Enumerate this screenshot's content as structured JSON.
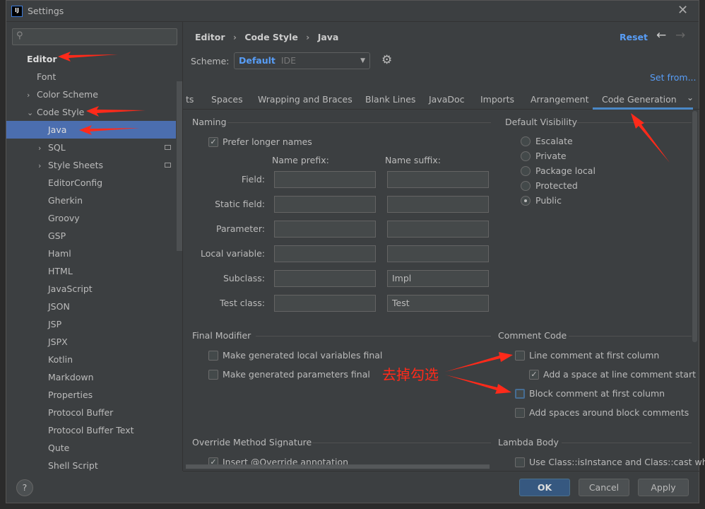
{
  "window": {
    "title": "Settings",
    "logo": "IJ"
  },
  "search": {
    "placeholder": ""
  },
  "sidebar": {
    "items": [
      {
        "label": "Editor",
        "level": 0,
        "bold": true
      },
      {
        "label": "Font",
        "level": 1
      },
      {
        "label": "Color Scheme",
        "level": 1,
        "chevron": "right"
      },
      {
        "label": "Code Style",
        "level": 1,
        "chevron": "down"
      },
      {
        "label": "Java",
        "level": 2,
        "selected": true
      },
      {
        "label": "SQL",
        "level": 2,
        "chevron": "right",
        "badge": true
      },
      {
        "label": "Style Sheets",
        "level": 2,
        "chevron": "right",
        "badge": true
      },
      {
        "label": "EditorConfig",
        "level": 2
      },
      {
        "label": "Gherkin",
        "level": 2
      },
      {
        "label": "Groovy",
        "level": 2
      },
      {
        "label": "GSP",
        "level": 2
      },
      {
        "label": "Haml",
        "level": 2
      },
      {
        "label": "HTML",
        "level": 2
      },
      {
        "label": "JavaScript",
        "level": 2
      },
      {
        "label": "JSON",
        "level": 2
      },
      {
        "label": "JSP",
        "level": 2
      },
      {
        "label": "JSPX",
        "level": 2
      },
      {
        "label": "Kotlin",
        "level": 2
      },
      {
        "label": "Markdown",
        "level": 2
      },
      {
        "label": "Properties",
        "level": 2
      },
      {
        "label": "Protocol Buffer",
        "level": 2
      },
      {
        "label": "Protocol Buffer Text",
        "level": 2
      },
      {
        "label": "Qute",
        "level": 2
      },
      {
        "label": "Shell Script",
        "level": 2
      }
    ]
  },
  "breadcrumb": [
    "Editor",
    "Code Style",
    "Java"
  ],
  "header": {
    "reset": "Reset",
    "scheme_label": "Scheme:",
    "scheme_value": "Default",
    "scheme_sub": "IDE",
    "set_from": "Set from..."
  },
  "tabs": [
    "ts",
    "Spaces",
    "Wrapping and Braces",
    "Blank Lines",
    "JavaDoc",
    "Imports",
    "Arrangement",
    "Code Generation"
  ],
  "active_tab": "Code Generation",
  "naming": {
    "title": "Naming",
    "prefer_longer": "Prefer longer names",
    "prefer_longer_checked": true,
    "prefix_header": "Name prefix:",
    "suffix_header": "Name suffix:",
    "rows": [
      {
        "label": "Field:",
        "prefix": "",
        "suffix": ""
      },
      {
        "label": "Static field:",
        "prefix": "",
        "suffix": ""
      },
      {
        "label": "Parameter:",
        "prefix": "",
        "suffix": ""
      },
      {
        "label": "Local variable:",
        "prefix": "",
        "suffix": ""
      },
      {
        "label": "Subclass:",
        "prefix": "",
        "suffix": "Impl"
      },
      {
        "label": "Test class:",
        "prefix": "",
        "suffix": "Test"
      }
    ]
  },
  "visibility": {
    "title": "Default Visibility",
    "options": [
      "Escalate",
      "Private",
      "Package local",
      "Protected",
      "Public"
    ],
    "selected": "Public"
  },
  "final_modifier": {
    "title": "Final Modifier",
    "items": [
      {
        "label": "Make generated local variables final",
        "checked": false
      },
      {
        "label": "Make generated parameters final",
        "checked": false
      }
    ]
  },
  "comment_code": {
    "title": "Comment Code",
    "items": [
      {
        "label": "Line comment at first column",
        "checked": false
      },
      {
        "label": "Add a space at line comment start",
        "checked": true
      },
      {
        "label": "Block comment at first column",
        "checked": false
      },
      {
        "label": "Add spaces around block comments",
        "checked": false
      }
    ]
  },
  "override": {
    "title": "Override Method Signature",
    "item": "Insert @Override annotation",
    "checked": true
  },
  "lambda": {
    "title": "Lambda Body",
    "item": "Use Class::isInstance and Class::cast when",
    "checked": false
  },
  "annotation": {
    "text": "去掉勾选",
    "color": "#ff2a1a"
  },
  "buttons": {
    "ok": "OK",
    "cancel": "Cancel",
    "apply": "Apply",
    "help": "?"
  },
  "colors": {
    "accent": "#4b6eaf",
    "link": "#589df6",
    "tab_underline": "#4a88c7"
  }
}
